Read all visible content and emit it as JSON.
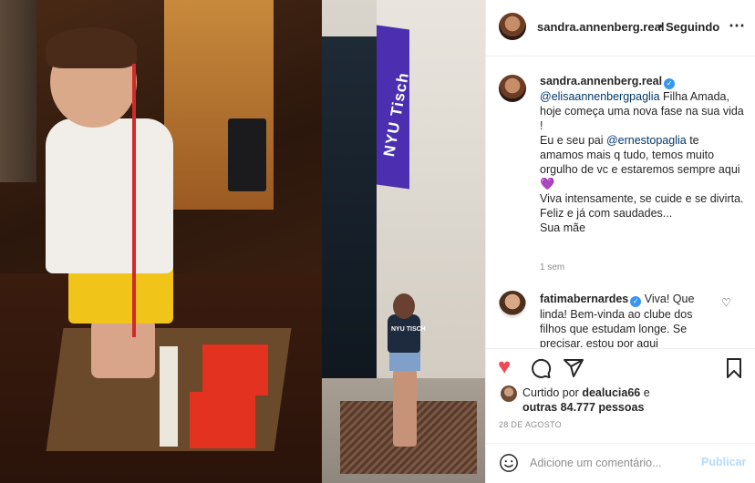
{
  "header": {
    "username": "sandra.annenberg.real",
    "separator": "•",
    "follow_status": "Seguindo",
    "more_icon": "ellipsis-icon"
  },
  "media": {
    "right_banner_text": "NYU Tisch",
    "shirt_text": "NYU TISCH"
  },
  "caption": {
    "username": "sandra.annenberg.real",
    "mention1": "@elisaannenbergpaglia",
    "text1": " Filha Amada, hoje começa uma nova fase na sua vida !",
    "text2a": "Eu e seu pai ",
    "mention2": "@ernestopaglia",
    "text2b": " te amamos mais q tudo, temos muito orgulho de vc e estaremos sempre aqui ",
    "heart": "💜",
    "text3": "Viva intensamente, se cuide e se divirta.",
    "text4": "Feliz e já com saudades...",
    "text5": "Sua mãe",
    "time": "1 sem"
  },
  "comment": {
    "username": "fatimabernardes",
    "text": " Viva! Que linda! Bem-vinda ao clube dos filhos que estudam longe. Se precisar, estou por aqui"
  },
  "actions": {
    "liked_by_prefix": "Curtido por ",
    "liked_by_user": "dealucia66",
    "liked_by_joiner": " e",
    "others": "outras 84.777 pessoas",
    "date": "28 DE AGOSTO"
  },
  "add_comment": {
    "placeholder": "Adicione um comentário...",
    "publish_label": "Publicar"
  },
  "colors": {
    "like_red": "#ed4956",
    "link_blue": "#00376b",
    "verified_blue": "#3897f0",
    "publish_disabled": "#b3dbff"
  }
}
